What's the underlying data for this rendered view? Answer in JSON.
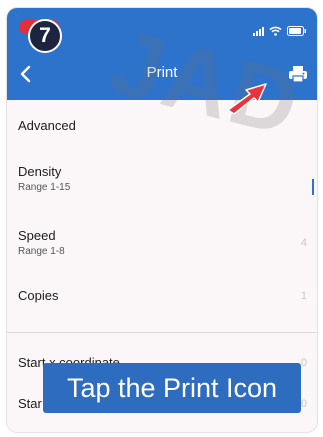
{
  "status_bar": {
    "recording_color": "#e0313a",
    "icons": [
      "signal-icon",
      "wifi-icon",
      "battery-icon"
    ]
  },
  "header": {
    "title": "Print",
    "back_icon": "chevron-left-icon",
    "action_icon": "printer-icon",
    "color": "#2d73cb"
  },
  "settings": {
    "advanced": {
      "label": "Advanced"
    },
    "density": {
      "label": "Density",
      "sub": "Range 1-15"
    },
    "speed": {
      "label": "Speed",
      "sub": "Range 1-8",
      "value": "4"
    },
    "copies": {
      "label": "Copies",
      "value": "1"
    },
    "start_x": {
      "label": "Start x coordinate",
      "value": "0"
    },
    "start_y": {
      "label": "Star",
      "value": "0"
    }
  },
  "overlay": {
    "step_number": "7",
    "watermark": "JAD",
    "caption": "Tap the Print Icon",
    "arrow_color": "#e8343c"
  }
}
